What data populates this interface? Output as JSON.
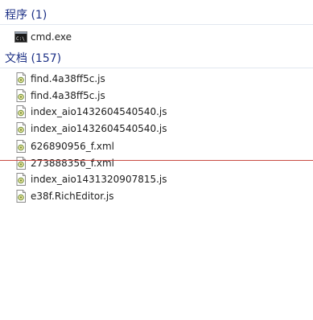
{
  "groups": {
    "programs": {
      "title": "程序 (1)",
      "items": [
        {
          "label": "cmd.exe",
          "icon": "cmd-console-icon"
        }
      ]
    },
    "documents": {
      "title": "文档 (157)",
      "items": [
        {
          "label": "find.4a38ff5c.js",
          "icon": "js-file-icon"
        },
        {
          "label": "find.4a38ff5c.js",
          "icon": "js-file-icon"
        },
        {
          "label": "index_aio1432604540540.js",
          "icon": "js-file-icon"
        },
        {
          "label": "index_aio1432604540540.js",
          "icon": "js-file-icon"
        },
        {
          "label": "626890956_f.xml",
          "icon": "xml-file-icon"
        },
        {
          "label": "273888356_f.xml",
          "icon": "xml-file-icon"
        },
        {
          "label": "index_aio1431320907815.js",
          "icon": "js-file-icon"
        },
        {
          "label": "e38f.RichEditor.js",
          "icon": "js-file-icon"
        }
      ]
    }
  },
  "colors": {
    "group_title": "#1e3287",
    "group_rule": "#e2e7ef",
    "overlay_line": "#c84b43"
  }
}
